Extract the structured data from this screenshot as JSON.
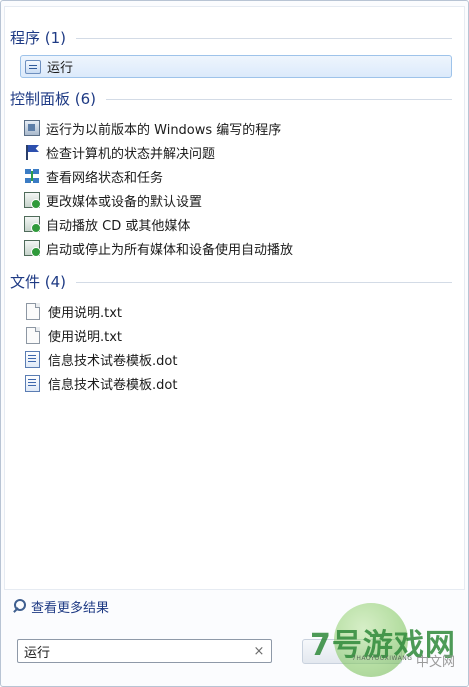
{
  "sections": {
    "programs": {
      "title": "程序 (1)",
      "items": [
        {
          "label": "运行",
          "icon": "run-icon"
        }
      ]
    },
    "control_panel": {
      "title": "控制面板 (6)",
      "items": [
        {
          "label": "运行为以前版本的 Windows 编写的程序",
          "icon": "compatibility-icon"
        },
        {
          "label": "检查计算机的状态并解决问题",
          "icon": "action-center-flag-icon"
        },
        {
          "label": "查看网络状态和任务",
          "icon": "network-icon"
        },
        {
          "label": "更改媒体或设备的默认设置",
          "icon": "autoplay-icon"
        },
        {
          "label": "自动播放 CD 或其他媒体",
          "icon": "autoplay-icon"
        },
        {
          "label": "启动或停止为所有媒体和设备使用自动播放",
          "icon": "autoplay-icon"
        }
      ]
    },
    "files": {
      "title": "文件 (4)",
      "items": [
        {
          "label": "使用说明.txt",
          "icon": "text-file-icon"
        },
        {
          "label": "使用说明.txt",
          "icon": "text-file-icon"
        },
        {
          "label": "信息技术试卷模板.dot",
          "icon": "word-template-icon"
        },
        {
          "label": "信息技术试卷模板.dot",
          "icon": "word-template-icon"
        }
      ]
    }
  },
  "more_results_label": "查看更多结果",
  "search": {
    "value": "运行",
    "clear_symbol": "×"
  },
  "watermark": {
    "main": "7号游戏网",
    "sub": "7HAOYOUXIWANG",
    "cn": "中文网"
  },
  "colors": {
    "section_title": "#1e3a84",
    "selection_border": "#9ec3ea"
  }
}
